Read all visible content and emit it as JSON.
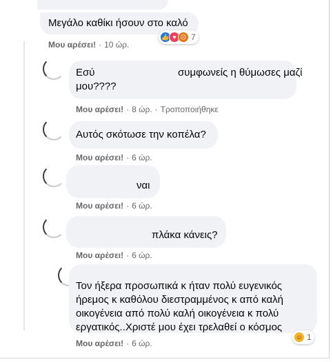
{
  "comments": [
    {
      "id": "c1",
      "text": "Μεγάλο καθίκι ήσουν στο καλό",
      "like_label": "Μου αρέσει!",
      "time": "10 ώρ.",
      "reaction_count": "7",
      "reactions": [
        "like-icon",
        "love-icon",
        "angry-icon"
      ]
    },
    {
      "id": "c2",
      "text_line1_start": "Εσύ",
      "text_line1_end": "συμφωνείς η θύμωσες μαζί",
      "text_line2": "μου????",
      "like_label": "Μου αρέσει!",
      "time": "8 ώρ.",
      "edited": "Τροποποιήθηκε"
    },
    {
      "id": "c3",
      "text": "Αυτός σκότωσε την κοπέλα?",
      "like_label": "Μου αρέσει!",
      "time": "6 ώρ."
    },
    {
      "id": "c4",
      "text": "ναι",
      "like_label": "Μου αρέσει!",
      "time": "6 ώρ."
    },
    {
      "id": "c5",
      "text": "πλάκα κάνεις?",
      "like_label": "Μου αρέσει!",
      "time": "6 ώρ."
    },
    {
      "id": "c6",
      "lines": [
        "Τον ήξερα προσωπικά κ ήταν πολύ ευγενικός",
        "ήρεμος κ καθόλου διεστραμμένος κ από καλή",
        "οικογένεια από πολύ καλή οικογένεια κ πολύ",
        "εργατικός..Χριστέ μου έχει τρελαθεί ο κόσμος"
      ],
      "like_label": "Μου αρέσει!",
      "time": "6 ώρ.",
      "reaction_count": "1",
      "reactions": [
        "haha-icon"
      ]
    }
  ],
  "colors": {
    "bubble": "#f0f2f5",
    "meta": "#65676b",
    "like_reaction": "#1877f2",
    "love_reaction": "#f33e58",
    "angry_reaction": "#e9710f",
    "haha_reaction": "#f7b125"
  }
}
